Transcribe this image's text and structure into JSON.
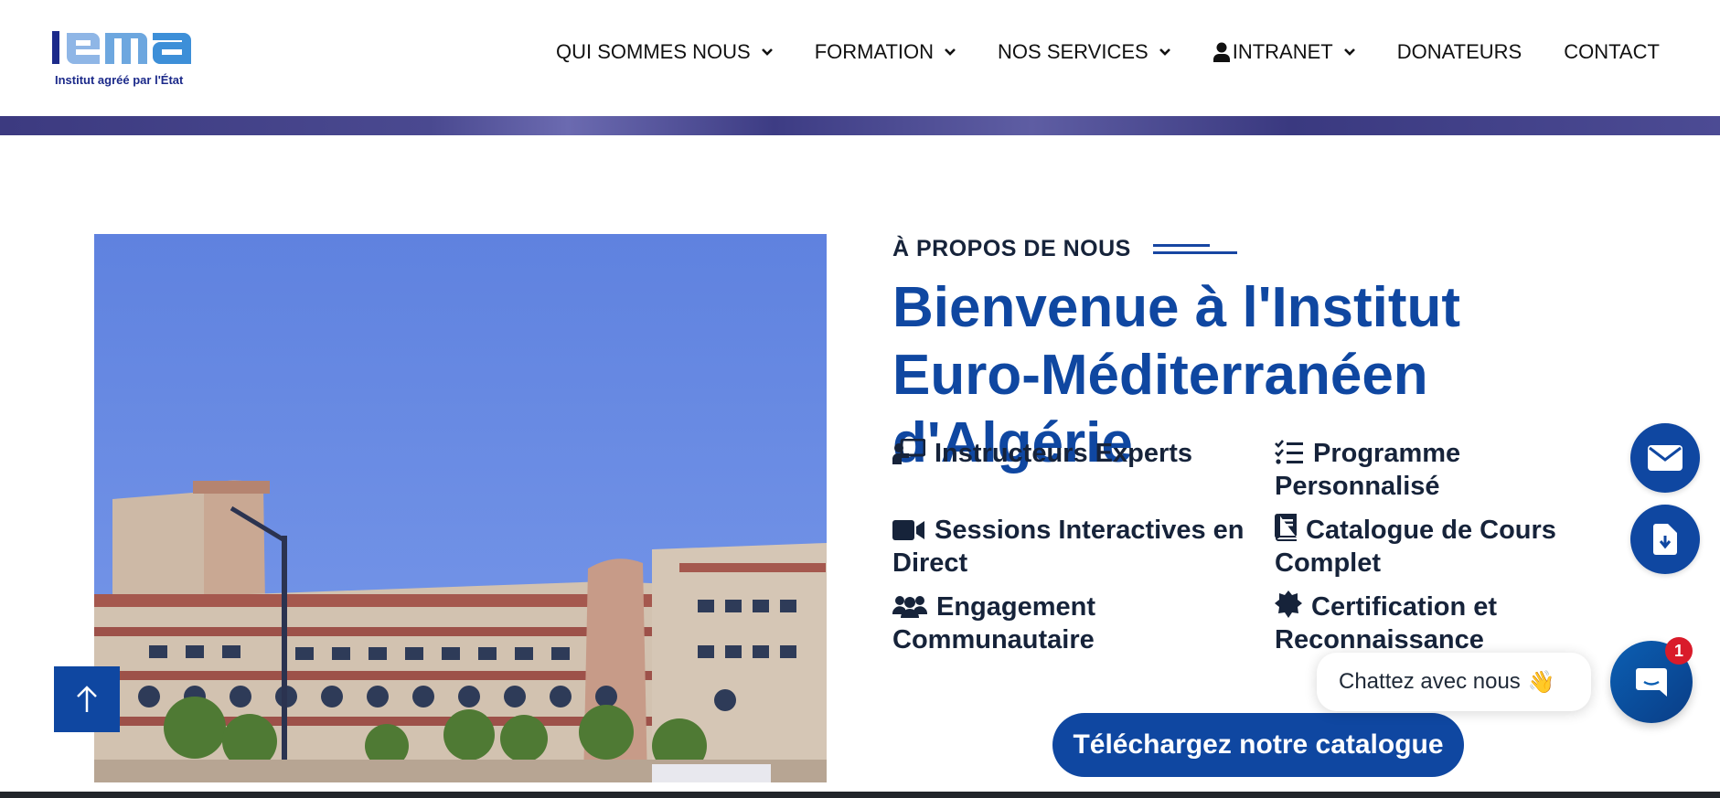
{
  "logo": {
    "text": "IEMA",
    "tagline": "Institut agréé par l'État"
  },
  "nav": {
    "items": [
      {
        "label": "QUI SOMMES NOUS",
        "dropdown": true
      },
      {
        "label": "FORMATION",
        "dropdown": true
      },
      {
        "label": "NOS SERVICES",
        "dropdown": true
      },
      {
        "label": "INTRANET",
        "dropdown": true,
        "icon": "user-icon"
      },
      {
        "label": "DONATEURS",
        "dropdown": false
      },
      {
        "label": "CONTACT",
        "dropdown": false
      }
    ]
  },
  "about": {
    "eyebrow": "À PROPOS DE NOUS",
    "headline": "Bienvenue à l'Institut Euro-Méditerranéen d'Algérie",
    "features": [
      {
        "label": "Instructeurs Experts",
        "icon": "chalkboard-teacher-icon"
      },
      {
        "label": "Programme Personnalisé",
        "icon": "checklist-icon"
      },
      {
        "label": "Sessions Interactives en Direct",
        "icon": "video-camera-icon"
      },
      {
        "label": "Catalogue de Cours Complet",
        "icon": "book-icon"
      },
      {
        "label": "Engagement Communautaire",
        "icon": "users-icon"
      },
      {
        "label": "Certification et Reconnaissance",
        "icon": "certificate-icon"
      }
    ],
    "cta": "Téléchargez notre catalogue"
  },
  "chat": {
    "prompt": "Chattez avec nous",
    "emoji": "👋",
    "badge": "1"
  },
  "colors": {
    "primary": "#0f47a1",
    "text": "#16233a",
    "badge": "#d91b2a"
  }
}
